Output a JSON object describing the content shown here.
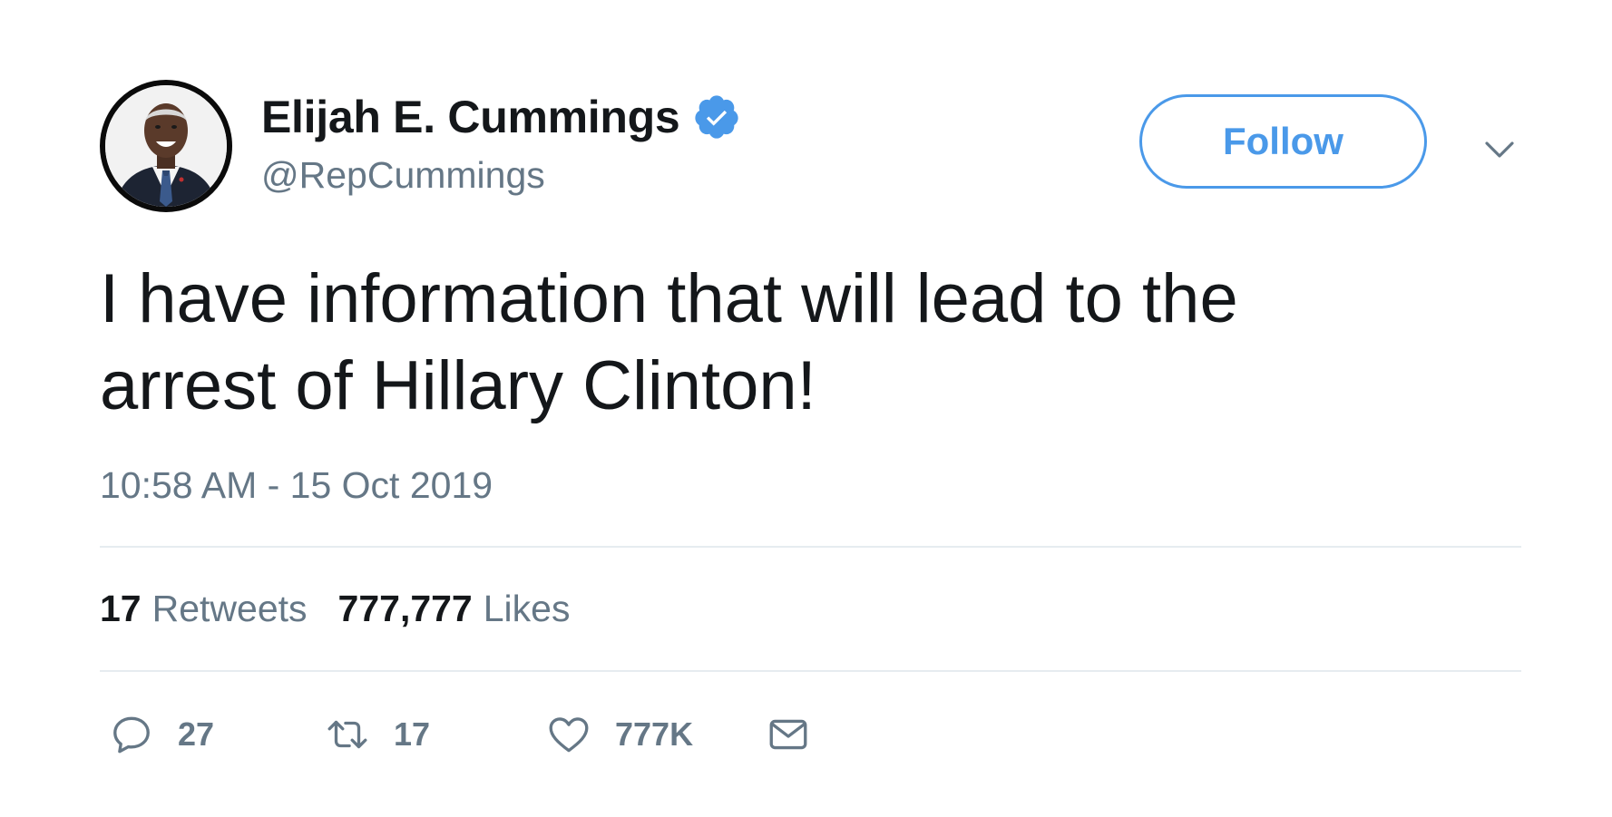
{
  "author": {
    "display_name": "Elijah E. Cummings",
    "handle": "@RepCummings",
    "verified": true,
    "avatar_icon": "profile-photo"
  },
  "header": {
    "follow_label": "Follow",
    "menu_icon": "chevron-down-icon"
  },
  "tweet": {
    "text": "I have information that will lead to the arrest of Hillary Clinton!",
    "timestamp": "10:58 AM - 15 Oct 2019"
  },
  "stats": {
    "retweets_count": "17",
    "retweets_label": "Retweets",
    "likes_count": "777,777",
    "likes_label": "Likes"
  },
  "actions": {
    "reply_count": "27",
    "retweet_count": "17",
    "like_count": "777K",
    "reply_icon": "reply-icon",
    "retweet_icon": "retweet-icon",
    "like_icon": "heart-icon",
    "dm_icon": "envelope-icon"
  },
  "colors": {
    "accent": "#4a99e9",
    "text": "#14171a",
    "muted": "#657786",
    "divider": "#e6ecf0"
  }
}
